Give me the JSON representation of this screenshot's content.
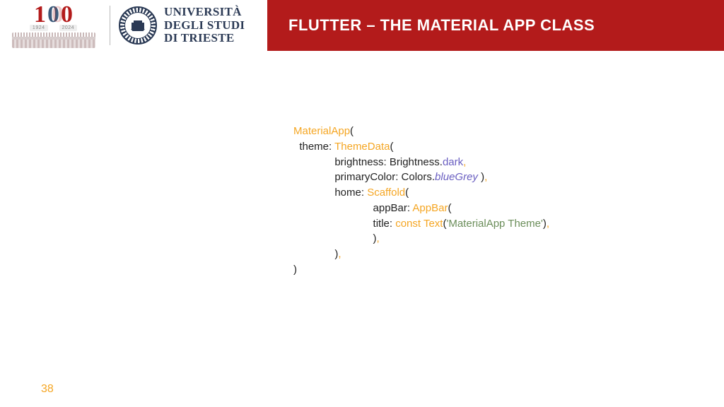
{
  "header": {
    "title": "FLUTTER – THE MATERIAL APP CLASS",
    "anniversary": {
      "year_from": "1924",
      "year_to": "2024"
    },
    "university": {
      "line1": "UNIVERSITÀ",
      "line2": "DEGLI STUDI",
      "line3": "DI TRIESTE"
    }
  },
  "code": {
    "t01": "MaterialApp",
    "t02": "(",
    "t03": "  theme: ",
    "t04": "ThemeData",
    "t05": "(",
    "t06": "              brightness: Brightness.",
    "t07": "dark",
    "t08": ",",
    "t09": "              primaryColor: Colors.",
    "t10": "blueGrey",
    "t11": " )",
    "t12": ",",
    "t13": "              home: ",
    "t14": "Scaffold",
    "t15": "(",
    "t16": "                           appBar: ",
    "t17": "AppBar",
    "t18": "(",
    "t19": "                           title: ",
    "t20": "const",
    "t21": " ",
    "t22": "Text",
    "t23": "(",
    "t24": "'MaterialApp Theme'",
    "t25": ")",
    "t26": ",",
    "t27": "                           )",
    "t28": ",",
    "t29": "              )",
    "t30": ",",
    "t31": ")"
  },
  "page_number": "38"
}
